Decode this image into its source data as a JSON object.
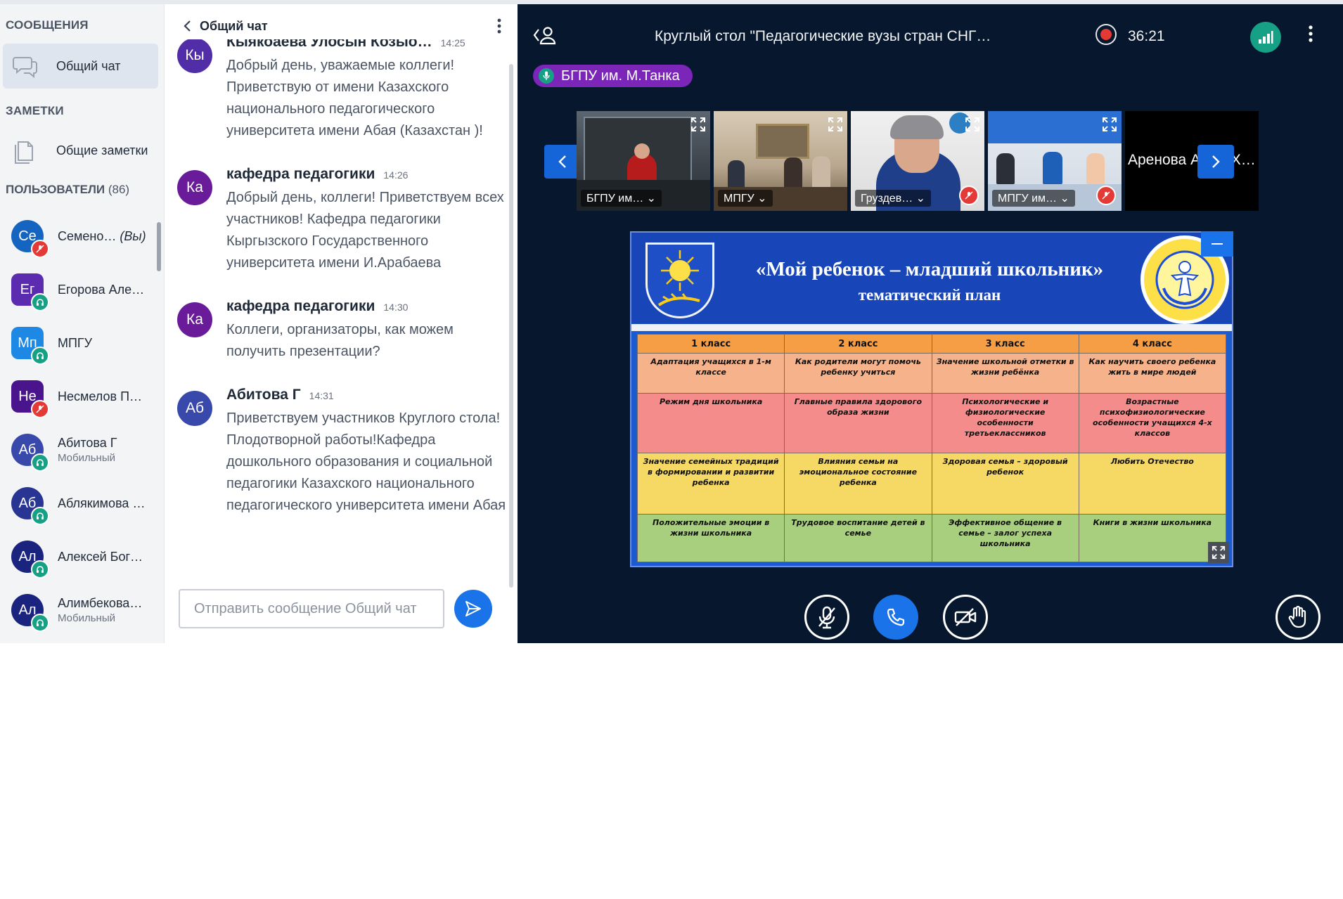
{
  "sidebar": {
    "messages_title": "СООБЩЕНИЯ",
    "public_chat": "Общий чат",
    "notes_title": "ЗАМЕТКИ",
    "shared_notes": "Общие заметки",
    "users_title": "ПОЛЬЗОВАТЕЛИ",
    "users_count": "(86)",
    "users": [
      {
        "initials": "Се",
        "name": "Семено…",
        "you": "(Вы)",
        "sub": "",
        "color": "#1565c0",
        "shape": "round",
        "status": "muted"
      },
      {
        "initials": "Ег",
        "name": "Егорова Але…",
        "you": "",
        "sub": "",
        "color": "#5b2bb0",
        "shape": "square",
        "status": "listen"
      },
      {
        "initials": "Мп",
        "name": "МПГУ",
        "you": "",
        "sub": "",
        "color": "#1e88e5",
        "shape": "square",
        "status": "listen"
      },
      {
        "initials": "Не",
        "name": "Несмелов П…",
        "you": "",
        "sub": "",
        "color": "#4a148c",
        "shape": "square",
        "status": "muted"
      },
      {
        "initials": "Аб",
        "name": "Абитова Г",
        "you": "",
        "sub": "Мобильный",
        "color": "#3949ab",
        "shape": "round",
        "status": "listen"
      },
      {
        "initials": "Аб",
        "name": "Аблякимова …",
        "you": "",
        "sub": "",
        "color": "#283593",
        "shape": "round",
        "status": "listen"
      },
      {
        "initials": "Ал",
        "name": "Алексей Бог…",
        "you": "",
        "sub": "",
        "color": "#1a237e",
        "shape": "round",
        "status": "listen"
      },
      {
        "initials": "Ал",
        "name": "Алимбекова…",
        "you": "",
        "sub": "Мобильный",
        "color": "#1a237e",
        "shape": "round",
        "status": "listen"
      }
    ]
  },
  "chat": {
    "title": "Общий чат",
    "messages": [
      {
        "initials": "Кы",
        "author": "Кыякоаева Улосын Козыо…",
        "time": "14:25",
        "color": "#512da8",
        "text": "Добрый день, уважаемые коллеги! Приветствую от имени Казахского национального педагогического университета имени Абая (Казахстан )!"
      },
      {
        "initials": "Ка",
        "author": "кафедра педагогики",
        "time": "14:26",
        "color": "#6a1b9a",
        "text": "Добрый день, коллеги! Приветствуем всех участников! Кафедра педагогики Кыргызского Государственного университета имени И.Арабаева"
      },
      {
        "initials": "Ка",
        "author": "кафедра педагогики",
        "time": "14:30",
        "color": "#6a1b9a",
        "text": "Коллеги, организаторы, как можем получить презентации?"
      },
      {
        "initials": "Аб",
        "author": "Абитова Г",
        "time": "14:31",
        "color": "#3949ab",
        "text": "Приветствуем участников Круглого стола! Плодотворной работы!Кафедра дошкольного образования и социальной педагогики Казахского национального педагогического университета имени Абая"
      }
    ],
    "input_placeholder": "Отправить сообщение Общий чат"
  },
  "conference": {
    "title": "Круглый стол \"Педагогические вузы стран СНГ для под…",
    "recording_time": "36:21",
    "speaker": "БГПУ им. М.Танка",
    "tiles": [
      {
        "label": "БГПУ им… ⌄",
        "muted": false
      },
      {
        "label": "МПГУ ⌄",
        "muted": false
      },
      {
        "label": "Груздев… ⌄",
        "muted": true
      },
      {
        "label": "МПГУ им… ⌄",
        "muted": true
      }
    ],
    "tile_name_only": "Аренова Асыл Х…",
    "slide": {
      "title": "«Мой ребенок – младший школьник»",
      "subtitle": "тематический план",
      "headers": [
        "1 класс",
        "2 класс",
        "3 класс",
        "4 класс"
      ],
      "rows": [
        [
          "Адаптация учащихся в 1-м классе",
          "Как родители могут помочь ребенку учиться",
          "Значение школьной отметки в жизни ребёнка",
          "Как научить своего ребенка жить в мире людей"
        ],
        [
          "Режим дня школьника",
          "Главные правила здорового образа жизни",
          "Психологические и физиологические особенности третьеклассников",
          "Возрастные психофизиологические особенности учащихся 4-х классов"
        ],
        [
          "Значение семейных традиций в формировании и развитии ребенка",
          "Влияния семьи на эмоциональное состояние ребенка",
          "Здоровая семья – здоровый ребенок",
          "Любить Отечество"
        ],
        [
          "Положительные эмоции в жизни школьника",
          "Трудовое воспитание детей в семье",
          "Эффективное общение в семье – залог успеха школьника",
          "Книги в жизни школьника"
        ]
      ]
    }
  },
  "colors": {
    "accent": "#1a73e8",
    "conference_bg": "#06172e",
    "recording": "#e53935",
    "speaker_pill": "#7b26b9",
    "connection_good": "#16a085"
  }
}
